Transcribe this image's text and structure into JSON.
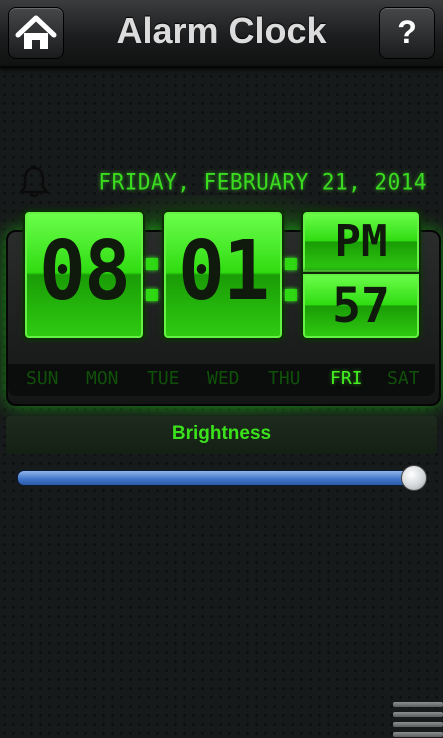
{
  "header": {
    "title": "Alarm Clock",
    "home_icon": "home-icon",
    "help_label": "?"
  },
  "alarm": {
    "bell_icon": "bell-icon",
    "date": "FRIDAY, FEBRUARY 21, 2014"
  },
  "clock": {
    "hours": "08",
    "minutes": "01",
    "ampm": "PM",
    "seconds": "57",
    "digit_color": "#2fd612"
  },
  "days": [
    {
      "label": "SUN",
      "active": false
    },
    {
      "label": "MON",
      "active": false
    },
    {
      "label": "TUE",
      "active": false
    },
    {
      "label": "WED",
      "active": false
    },
    {
      "label": "THU",
      "active": false
    },
    {
      "label": "FRI",
      "active": true
    },
    {
      "label": "SAT",
      "active": false
    }
  ],
  "brightness": {
    "label": "Brightness",
    "level": 0.99
  },
  "footer": {
    "menu_icon": "menu-icon"
  }
}
